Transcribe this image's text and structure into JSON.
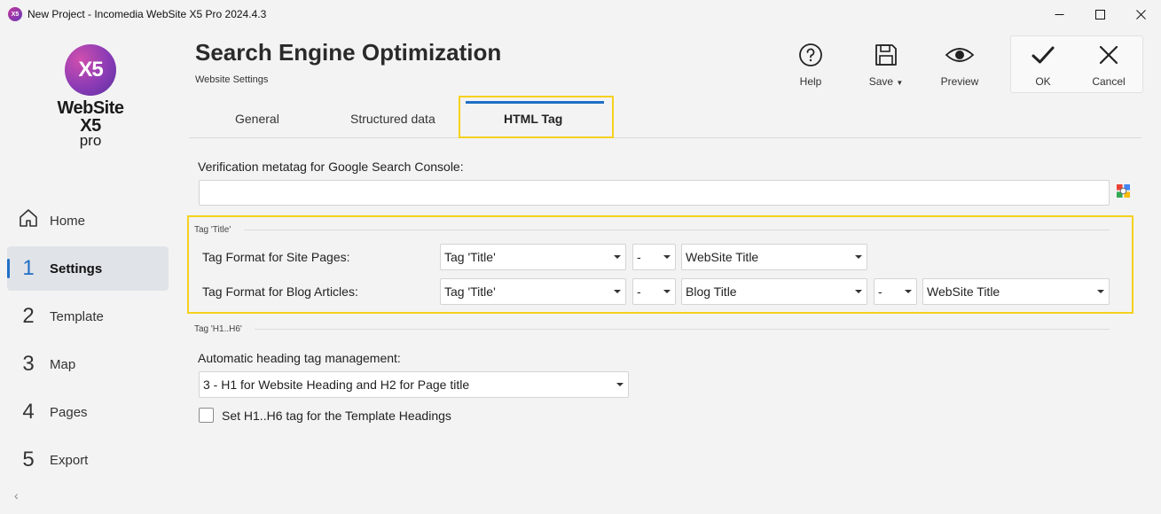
{
  "window": {
    "title": "New Project - Incomedia WebSite X5 Pro 2024.4.3",
    "app_icon": "X5"
  },
  "logo": {
    "mark": "X5",
    "name": "WebSite X5",
    "edition": "pro"
  },
  "nav": {
    "items": [
      {
        "num": "",
        "label": "Home",
        "icon": "home-icon"
      },
      {
        "num": "1",
        "label": "Settings"
      },
      {
        "num": "2",
        "label": "Template"
      },
      {
        "num": "3",
        "label": "Map"
      },
      {
        "num": "4",
        "label": "Pages"
      },
      {
        "num": "5",
        "label": "Export"
      }
    ],
    "active": "Settings"
  },
  "header": {
    "title": "Search Engine Optimization",
    "subtitle": "Website Settings"
  },
  "toolbar": {
    "help": "Help",
    "save": "Save",
    "preview": "Preview",
    "ok": "OK",
    "cancel": "Cancel"
  },
  "tabs": {
    "general": "General",
    "structured": "Structured data",
    "html_tag": "HTML Tag",
    "active": "HTML Tag"
  },
  "verification": {
    "label": "Verification metatag for Google Search Console:",
    "value": ""
  },
  "title_section": {
    "heading": "Tag 'Title'",
    "site_pages": {
      "label": "Tag Format for Site Pages:",
      "sel1": "Tag 'Title'",
      "sep1": "-",
      "sel2": "WebSite Title"
    },
    "blog_articles": {
      "label": "Tag Format for Blog Articles:",
      "sel1": "Tag 'Title'",
      "sep1": "-",
      "sel2": "Blog Title",
      "sep2": "-",
      "sel3": "WebSite Title"
    }
  },
  "heading_section": {
    "heading": "Tag 'H1..H6'",
    "auto_label": "Automatic heading tag management:",
    "auto_value": "3 - H1 for Website Heading and H2 for Page title",
    "template_checkbox_label": "Set H1..H6 tag for the Template Headings",
    "template_checkbox_checked": false
  },
  "colors": {
    "accent": "#1f6fc5",
    "highlight": "#f5d11c"
  }
}
